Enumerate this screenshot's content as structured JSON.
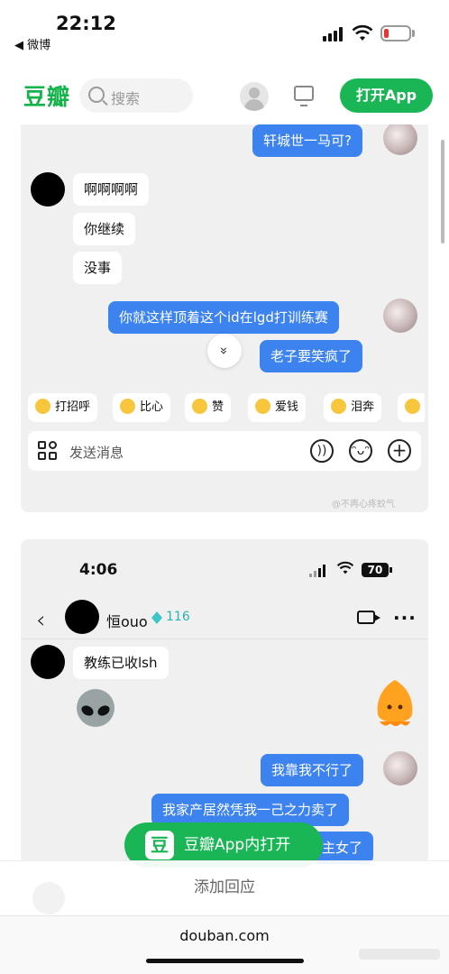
{
  "status_bar": {
    "time": "22:12",
    "back_app": "◀ 微博"
  },
  "header": {
    "logo": "豆瓣",
    "search_placeholder": "搜索",
    "open_app": "打开App"
  },
  "chat1": {
    "messages": [
      {
        "side": "right",
        "text": "轩城世一马可?"
      },
      {
        "side": "left",
        "text": "啊啊啊啊"
      },
      {
        "side": "left",
        "text": "你继续"
      },
      {
        "side": "left",
        "text": "没事"
      },
      {
        "side": "right",
        "text": "你就这样顶着这个id在lgd打训练赛"
      },
      {
        "side": "right",
        "text": "老子要笑疯了"
      }
    ],
    "scroll_down": "»",
    "quick_replies": [
      "打招呼",
      "比心",
      "赞",
      "爱钱",
      "泪奔"
    ],
    "input_placeholder": "发送消息",
    "watermark": "@不再心疼蚊气"
  },
  "chat2": {
    "status_time": "4:06",
    "battery": "70",
    "contact_name": "恒ouo",
    "contact_level": "116",
    "messages": [
      {
        "side": "left",
        "text": "教练已收lsh"
      },
      {
        "side": "left",
        "type": "sticker",
        "icon": "alien-icon"
      },
      {
        "side": "right",
        "type": "sticker",
        "icon": "orange-blob-sticker"
      },
      {
        "side": "right",
        "text": "我靠我不行了"
      },
      {
        "side": "right",
        "text": "我家产居然凭我一己之力卖了"
      },
      {
        "side": "right",
        "text": "主女了"
      }
    ]
  },
  "floating_button": {
    "logo": "豆",
    "label": "豆瓣App内打开"
  },
  "reply_bar": {
    "label": "添加回应"
  },
  "browser": {
    "url": "douban.com"
  },
  "colors": {
    "brand_green": "#1ab655",
    "bubble_blue": "#3d83f0",
    "card_bg": "#f0f0f0"
  }
}
